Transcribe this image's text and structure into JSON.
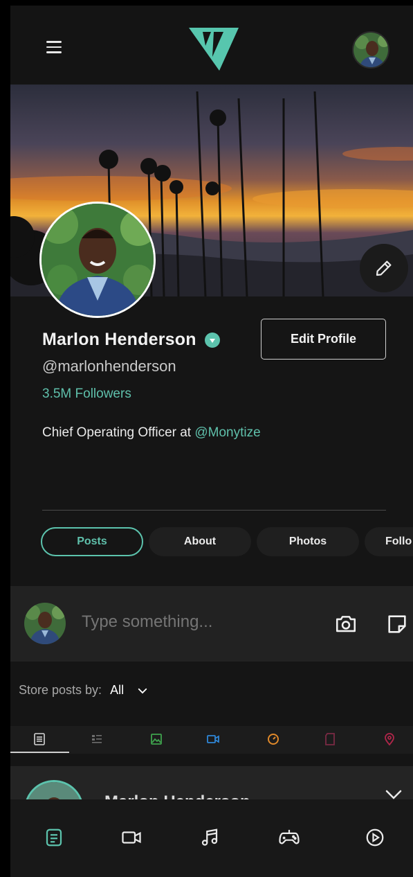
{
  "header": {
    "menu_icon": "hamburger-icon",
    "logo": "monytize-logo",
    "avatar_alt": "user-avatar"
  },
  "profile": {
    "name": "Marlon Henderson",
    "handle": "@marlonhenderson",
    "followers": "3.5M Followers",
    "bio_prefix": "Chief Operating Officer at",
    "bio_mention": "@Monytize",
    "edit_profile_label": "Edit Profile",
    "verified": true
  },
  "tabs": [
    {
      "label": "Posts",
      "active": true
    },
    {
      "label": "About",
      "active": false
    },
    {
      "label": "Photos",
      "active": false
    },
    {
      "label": "Follo",
      "active": false
    }
  ],
  "composer": {
    "placeholder": "Type something...",
    "camera_icon": "camera-icon",
    "note_icon": "note-icon"
  },
  "sort": {
    "label": "Store posts by:",
    "value": "All"
  },
  "filters": [
    {
      "icon": "list-icon",
      "color": "#d6d6d6",
      "active": true
    },
    {
      "icon": "article-icon",
      "color": "#6e6e6e"
    },
    {
      "icon": "image-icon",
      "color": "#3fa34d"
    },
    {
      "icon": "video-icon",
      "color": "#2f86d6"
    },
    {
      "icon": "audio-icon",
      "color": "#e0892a"
    },
    {
      "icon": "file-icon",
      "color": "#7a2a44"
    },
    {
      "icon": "location-icon",
      "color": "#b0264a"
    }
  ],
  "post": {
    "author": "Marlon Henderson"
  },
  "bottom_nav": [
    {
      "icon": "posts-icon",
      "active": true
    },
    {
      "icon": "video-icon"
    },
    {
      "icon": "music-icon"
    },
    {
      "icon": "gamepad-icon"
    },
    {
      "icon": "play-icon"
    }
  ],
  "colors": {
    "accent": "#5cc3ad",
    "background": "#151515"
  }
}
